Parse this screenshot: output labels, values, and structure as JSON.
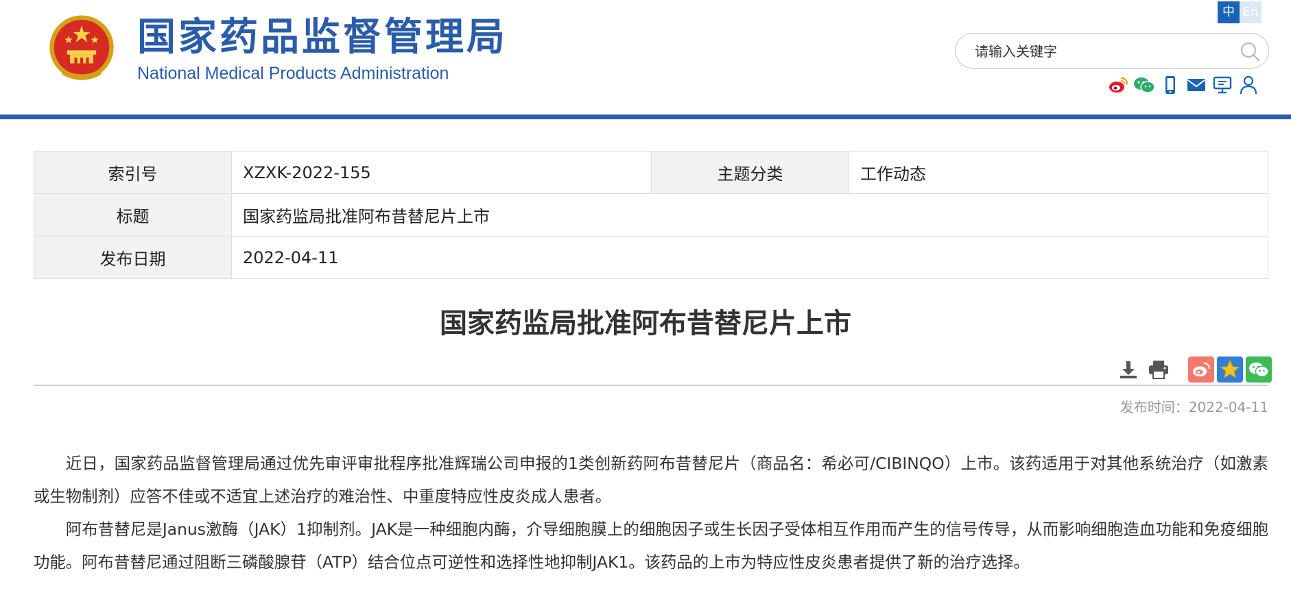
{
  "header": {
    "site_title": "国家药品监督管理局",
    "site_subtitle": "National Medical Products Administration",
    "lang_zh": "中",
    "lang_en": "En",
    "search_placeholder": "请输入关键字",
    "social_icons": [
      "weibo-icon",
      "wechat-icon",
      "mobile-icon",
      "mail-icon",
      "monitor-icon",
      "user-icon"
    ],
    "brand_color": "#2a5caa"
  },
  "info_table": {
    "index_label": "索引号",
    "index_value": "XZXK-2022-155",
    "category_label": "主题分类",
    "category_value": "工作动态",
    "title_label": "标题",
    "title_value": "国家药监局批准阿布昔替尼片上市",
    "date_label": "发布日期",
    "date_value": "2022-04-11"
  },
  "article": {
    "title": "国家药监局批准阿布昔替尼片上市",
    "publish_time": "发布时间：2022-04-11",
    "paragraphs": [
      "近日，国家药品监督管理局通过优先审评审批程序批准辉瑞公司申报的1类创新药阿布昔替尼片（商品名：希必可/CIBINQO）上市。该药适用于对其他系统治疗（如激素或生物制剂）应答不佳或不适宜上述治疗的难治性、中重度特应性皮炎成人患者。",
      "阿布昔替尼是Janus激酶（JAK）1抑制剂。JAK是一种细胞内酶，介导细胞膜上的细胞因子或生长因子受体相互作用而产生的信号传导，从而影响细胞造血功能和免疫细胞功能。阿布昔替尼通过阻断三磷酸腺苷（ATP）结合位点可逆性和选择性地抑制JAK1。该药品的上市为特应性皮炎患者提供了新的治疗选择。"
    ],
    "tools": [
      "download-icon",
      "print-icon"
    ],
    "share": [
      "weibo-share-icon",
      "favorite-star-icon",
      "wechat-share-icon"
    ]
  }
}
